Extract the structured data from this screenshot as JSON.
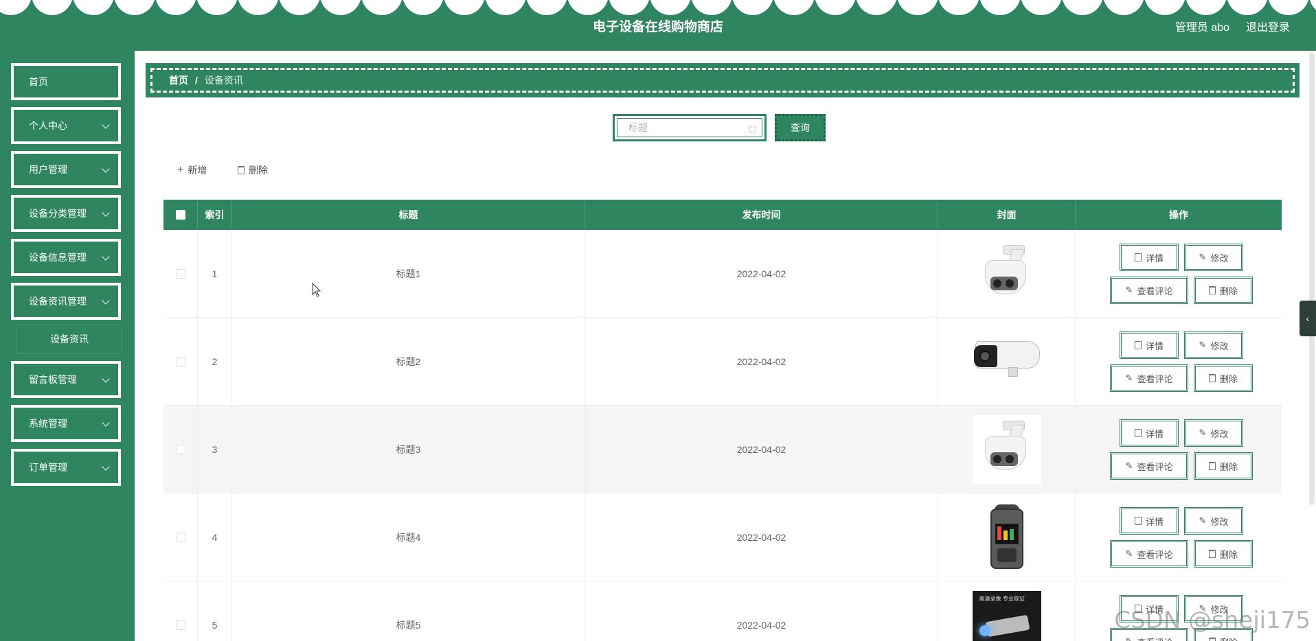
{
  "header": {
    "title": "电子设备在线购物商店",
    "admin_label": "管理员 abo",
    "logout_label": "退出登录"
  },
  "sidebar": {
    "items": [
      {
        "label": "首页",
        "has_arrow": false
      },
      {
        "label": "个人中心",
        "has_arrow": true
      },
      {
        "label": "用户管理",
        "has_arrow": true
      },
      {
        "label": "设备分类管理",
        "has_arrow": true
      },
      {
        "label": "设备信息管理",
        "has_arrow": true
      },
      {
        "label": "设备资讯管理",
        "has_arrow": true
      },
      {
        "label": "留言板管理",
        "has_arrow": true
      },
      {
        "label": "系统管理",
        "has_arrow": true
      },
      {
        "label": "订单管理",
        "has_arrow": true
      }
    ],
    "submenu": {
      "label": "设备资讯"
    }
  },
  "breadcrumb": {
    "home": "首页",
    "separator": "/",
    "current": "设备资讯"
  },
  "search": {
    "placeholder": "标题",
    "button_label": "查询"
  },
  "toolbar": {
    "add_label": "新增",
    "delete_label": "删除"
  },
  "table": {
    "columns": [
      "索引",
      "标题",
      "发布时间",
      "封面",
      "操作"
    ],
    "rows": [
      {
        "index": "1",
        "title": "标题1",
        "date": "2022-04-02",
        "cover": "dome-camera"
      },
      {
        "index": "2",
        "title": "标题2",
        "date": "2022-04-02",
        "cover": "bullet-camera"
      },
      {
        "index": "3",
        "title": "标题3",
        "date": "2022-04-02",
        "cover": "dome-camera"
      },
      {
        "index": "4",
        "title": "标题4",
        "date": "2022-04-02",
        "cover": "voice-recorder"
      },
      {
        "index": "5",
        "title": "标题5",
        "date": "2022-04-02",
        "cover": "promo-image"
      }
    ],
    "actions": {
      "detail": "详情",
      "edit": "修改",
      "comments": "查看评论",
      "delete": "删除"
    },
    "promo_text": {
      "line1": "高清录像 专业取证"
    }
  },
  "watermark": "CSDN @sheji175",
  "colors": {
    "primary": "#2e8560",
    "row_alt": "#f5f5f5",
    "border": "#ebeef5"
  }
}
